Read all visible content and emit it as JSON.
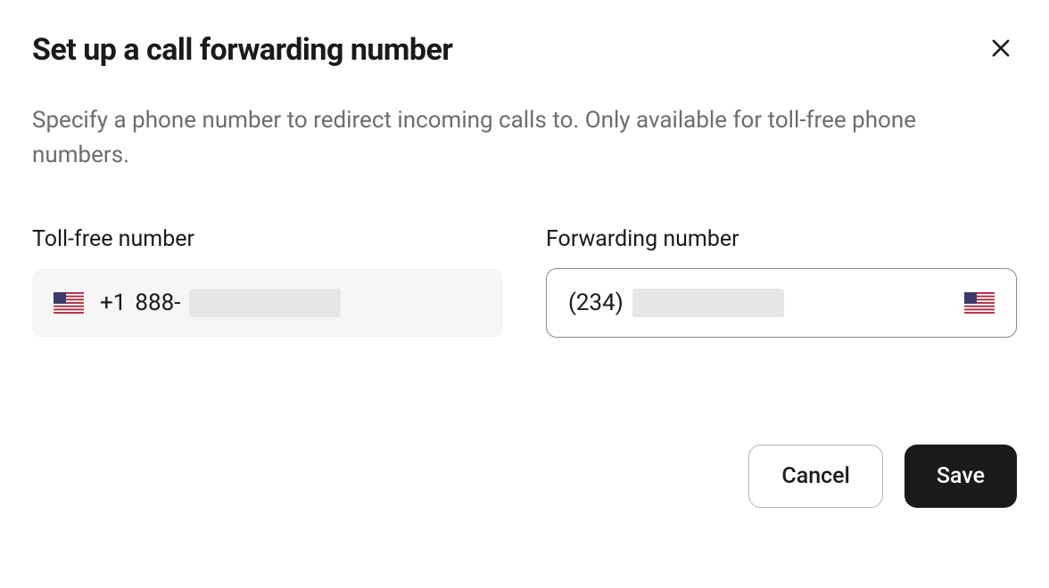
{
  "header": {
    "title": "Set up a call forwarding number"
  },
  "description": "Specify a phone number to redirect incoming calls to. Only available for toll-free phone numbers.",
  "fields": {
    "tollFree": {
      "label": "Toll-free number",
      "prefix": "+1",
      "areaCode": "888-"
    },
    "forwarding": {
      "label": "Forwarding number",
      "areaCode": "(234)"
    }
  },
  "icons": {
    "flag": "us-flag"
  },
  "buttons": {
    "cancel": "Cancel",
    "save": "Save"
  }
}
